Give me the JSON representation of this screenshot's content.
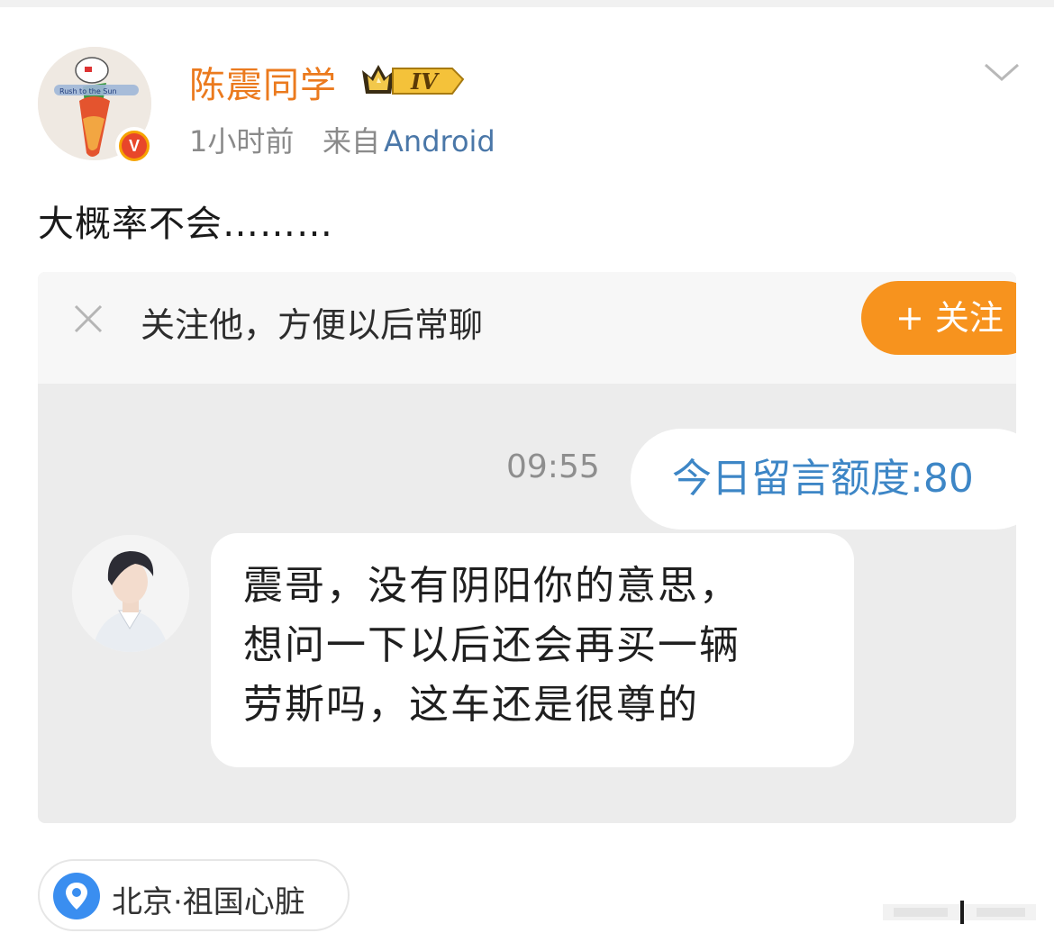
{
  "post": {
    "author": {
      "username": "陈震同学",
      "level_badge": "IV",
      "avatar_text": "Rush to the Sun"
    },
    "meta": {
      "time": "1小时前",
      "source_prefix": "来自",
      "source": "Android"
    },
    "text": "大概率不会………",
    "location": {
      "label": "北京·祖国心脏"
    }
  },
  "embedded_screenshot": {
    "follow_bar": {
      "prompt": "关注他，方便以后常聊",
      "follow_button": "+ 关注"
    },
    "chat": {
      "time": "09:55",
      "sent_message": "今日留言额度:80",
      "received_message_lines": [
        "震哥，没有阴阳你的意思，",
        "想问一下以后还会再买一辆",
        "劳斯吗，这车还是很尊的"
      ]
    }
  },
  "colors": {
    "username": "#eb7a1e",
    "source_link": "#4a77a8",
    "follow_button": "#f7931e",
    "sent_text": "#3d86c6",
    "location_pin": "#3a8ef0"
  }
}
